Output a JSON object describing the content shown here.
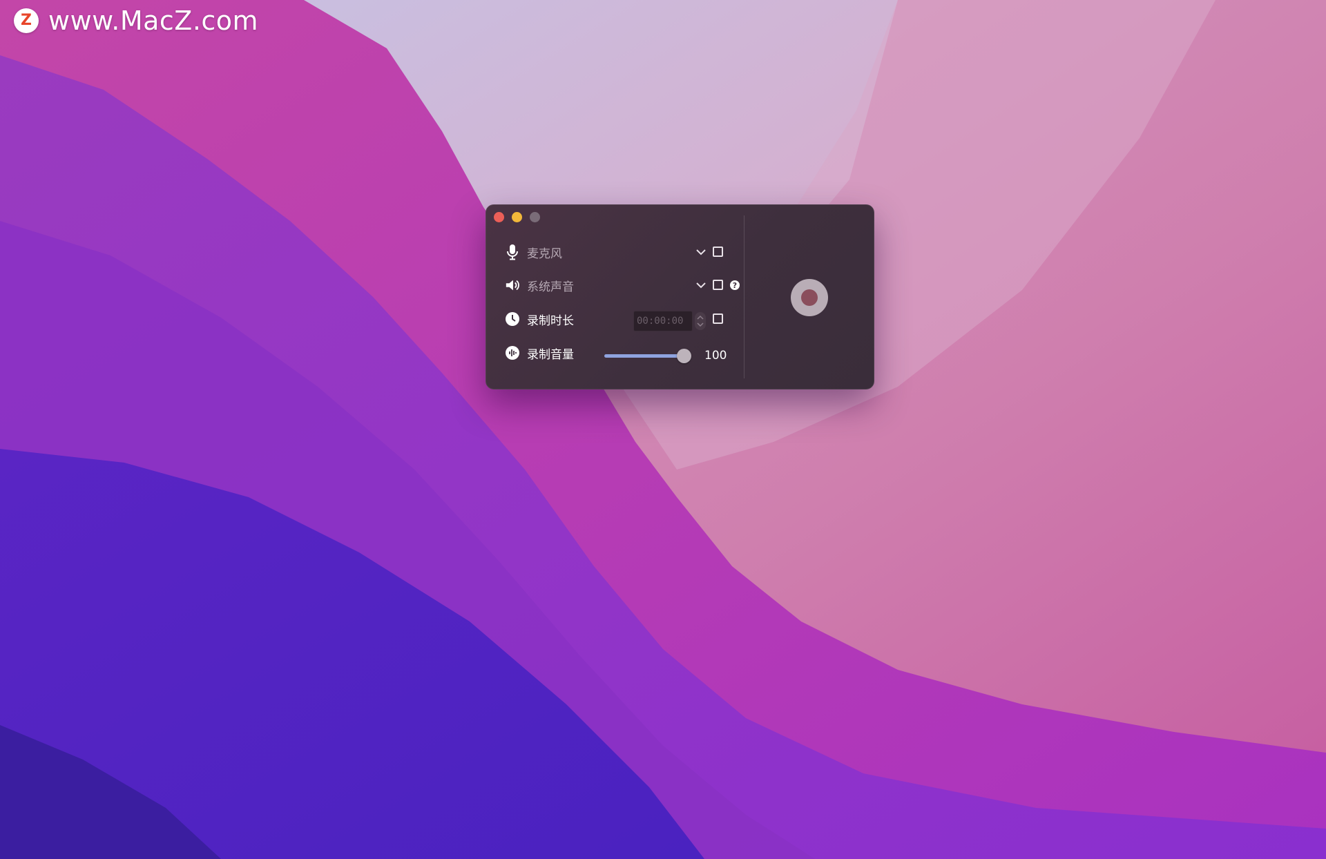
{
  "watermark": {
    "logo_letter": "Z",
    "text": "www.MacZ.com"
  },
  "window": {
    "rows": [
      {
        "icon": "microphone-icon",
        "label": "麦克风",
        "has_dropdown": true,
        "checked": false
      },
      {
        "icon": "speaker-icon",
        "label": "系统声音",
        "has_dropdown": true,
        "checked": false,
        "has_help": true
      },
      {
        "icon": "clock-icon",
        "label": "录制时长",
        "time_value": "00:00:00",
        "checked": false
      },
      {
        "icon": "volume-meter-icon",
        "label": "录制音量"
      }
    ],
    "help_glyph": "?",
    "volume": {
      "value": "100",
      "level": 100,
      "max": 100
    },
    "colors": {
      "accent_fill": "#8fa3df",
      "record_button": "#b9adb6",
      "record_dot": "#8a4e5c"
    }
  }
}
